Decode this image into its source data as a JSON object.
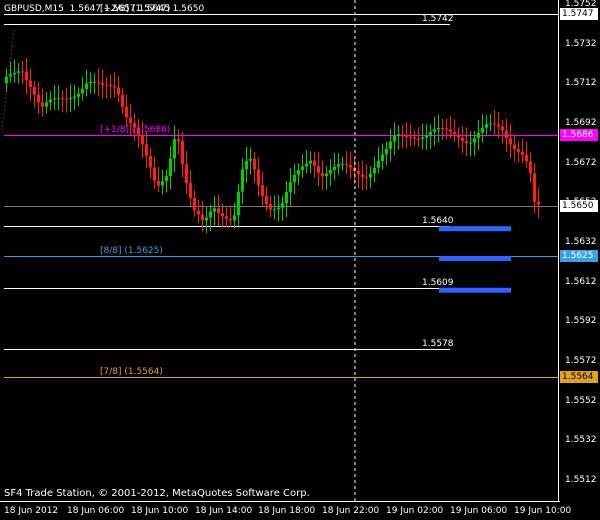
{
  "header": {
    "symbol_timeframe": "GBPUSD,M15",
    "ohlc": "1.5647 1.5657 1.5645 1.5650"
  },
  "copyright": "SF4 Trade Station, © 2001-2012, MetaQuotes Software Corp.",
  "colors": {
    "background": "#000000",
    "bull_candle": "#00d000",
    "bear_candle": "#ff1e1e",
    "murrey_plus2": "#ffffff",
    "murrey_plus1": "#ff00ff",
    "murrey_8": "#3aa0e0",
    "murrey_7": "#e0a020",
    "bar_blue": "#2e63ff",
    "current_price": "#ffffff"
  },
  "murrey_levels": [
    {
      "label": "[+2/8]  (1.5747)",
      "price": 1.5747,
      "color": "#ffffff"
    },
    {
      "label": "[+1/8]  (1.5686)",
      "price": 1.5686,
      "color": "#ff00ff"
    },
    {
      "label": "[8/8]  (1.5625)",
      "price": 1.5625,
      "color": "#3aa0e0"
    },
    {
      "label": "[7/8]  (1.5564)",
      "price": 1.5564,
      "color": "#e0a020"
    }
  ],
  "price_levels": [
    {
      "label": "1.5742",
      "price": 1.5742
    },
    {
      "label": "1.5640",
      "price": 1.564
    },
    {
      "label": "1.5609",
      "price": 1.5609
    },
    {
      "label": "1.5578",
      "price": 1.5578
    }
  ],
  "blue_bars": [
    {
      "price": 1.564
    },
    {
      "price": 1.5625
    },
    {
      "price": 1.5609
    }
  ],
  "price_axis": {
    "ticks": [
      "1.5752",
      "1.5732",
      "1.5712",
      "1.5692",
      "1.5672",
      "1.5652",
      "1.5632",
      "1.5612",
      "1.5592",
      "1.5572",
      "1.5552",
      "1.5532",
      "1.5512"
    ],
    "boxes": [
      {
        "label": "1.5747",
        "price": 1.5747,
        "bg": "#ffffff",
        "fg": "#000000"
      },
      {
        "label": "1.5686",
        "price": 1.5686,
        "bg": "#ff00ff",
        "fg": "#ffffff"
      },
      {
        "label": "1.5650",
        "price": 1.565,
        "bg": "#ffffff",
        "fg": "#000000"
      },
      {
        "label": "1.5625",
        "price": 1.5625,
        "bg": "#3aa0e0",
        "fg": "#ffffff"
      },
      {
        "label": "1.5564",
        "price": 1.5564,
        "bg": "#e0a020",
        "fg": "#000000"
      }
    ]
  },
  "time_axis": {
    "labels": [
      "18 Jun 2012",
      "18 Jun 06:00",
      "18 Jun 10:00",
      "18 Jun 14:00",
      "18 Jun 18:00",
      "18 Jun 22:00",
      "19 Jun 02:00",
      "19 Jun 06:00",
      "19 Jun 10:00"
    ]
  },
  "current_price": 1.565
}
